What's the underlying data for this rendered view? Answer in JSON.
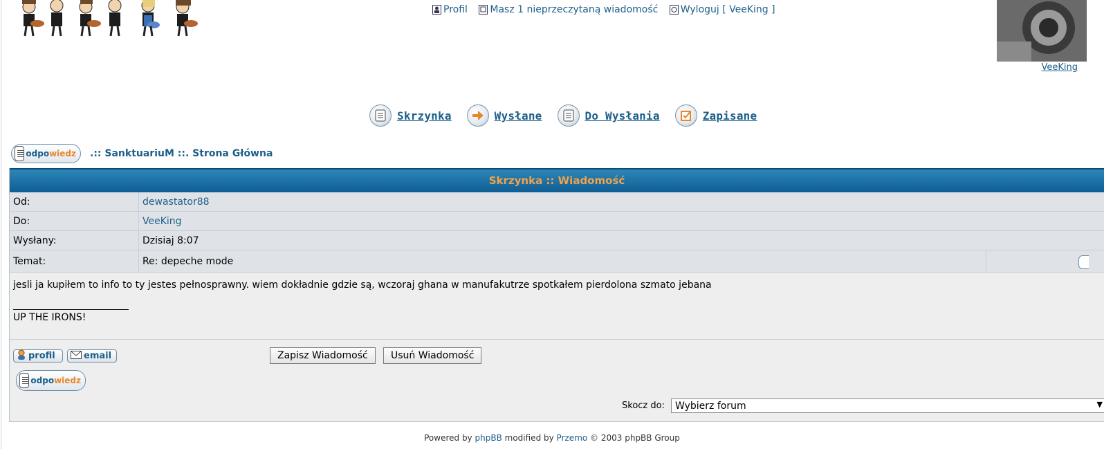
{
  "header": {
    "top_links": [
      {
        "label": "Profil",
        "icon": "profile-icon"
      },
      {
        "label": "Masz 1 nieprzeczytaną wiadomość",
        "icon": "message-icon"
      },
      {
        "label": "Wyloguj [ VeeKing ]",
        "icon": "logout-icon"
      }
    ],
    "avatar_name": "VeeKing"
  },
  "folders": [
    {
      "label": "Skrzynka",
      "icon": "inbox-icon"
    },
    {
      "label": "Wysłane",
      "icon": "arrow-right-icon"
    },
    {
      "label": "Do Wysłania",
      "icon": "outbox-icon"
    },
    {
      "label": "Zapisane",
      "icon": "saved-checkbox-icon"
    }
  ],
  "reply_button": {
    "prefix": "odpo",
    "accent": "wiedz"
  },
  "breadcrumb": ".:: SanktuariuM ::. Strona Główna",
  "message": {
    "title": "Skrzynka :: Wiadomość",
    "fields": [
      {
        "label": "Od:",
        "value": "dewastator88"
      },
      {
        "label": "Do:",
        "value": "VeeKing"
      },
      {
        "label": "Wysłany:",
        "value": "Dzisiaj 8:07"
      },
      {
        "label": "Temat:",
        "value": "Re: depeche mode"
      }
    ],
    "body": "jesli ja kupiłem to info to ty jestes pełnosprawny. wiem dokładnie gdzie są, wczoraj ghana w manufakutrze spotkałem pierdolona szmato jebana",
    "signature": "UP THE IRONS!"
  },
  "actions": {
    "profile_label": "profil",
    "email_label": "email",
    "save_label": "Zapisz Wiadomość",
    "delete_label": "Usuń Wiadomość"
  },
  "jump": {
    "label": "Skocz do:",
    "selected": "Wybierz forum"
  },
  "footer": {
    "powered": "Powered by",
    "phpbb": "phpBB",
    "modified": "modified by",
    "przemo": "Przemo",
    "copyright": "© 2003 phpBB Group"
  },
  "colors": {
    "link": "#1d5f8a",
    "header_bar": "#1a6fa3",
    "header_text": "#f3a24a",
    "accent_orange": "#e8862a"
  }
}
